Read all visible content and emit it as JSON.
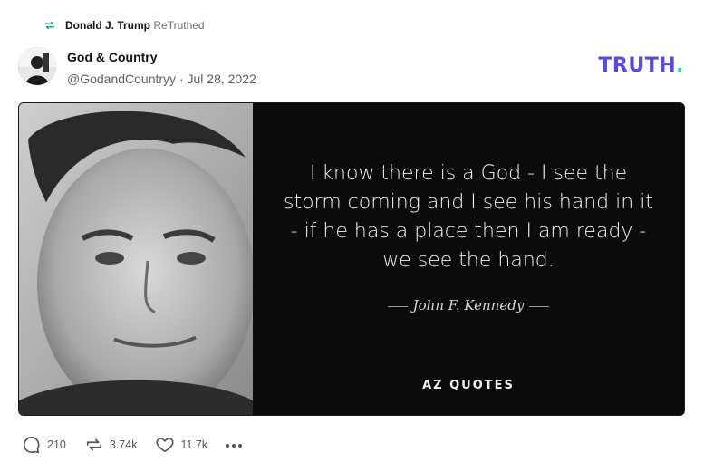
{
  "retruth": {
    "user": "Donald J. Trump",
    "label": "ReTruthed",
    "icon": "retruth-icon"
  },
  "post": {
    "author_name": "God & Country",
    "handle": "@GodandCountryy",
    "date": "Jul 28, 2022",
    "handle_line": "@GodandCountryy · Jul 28, 2022"
  },
  "brand": {
    "logo_text": "TRUTH",
    "logo_dot": ".",
    "colors": {
      "primary": "#5448ee",
      "accent": "#17e0b4"
    }
  },
  "media": {
    "quote_lines": [
      "I know there is a God - I see the",
      "storm coming and I see his hand in it",
      "- if he has a place then I am ready -",
      "we see the hand."
    ],
    "quote_author": "John F. Kennedy",
    "watermark": "AZ QUOTES"
  },
  "actions": {
    "replies": "210",
    "retruths": "3.74k",
    "likes": "11.7k"
  }
}
